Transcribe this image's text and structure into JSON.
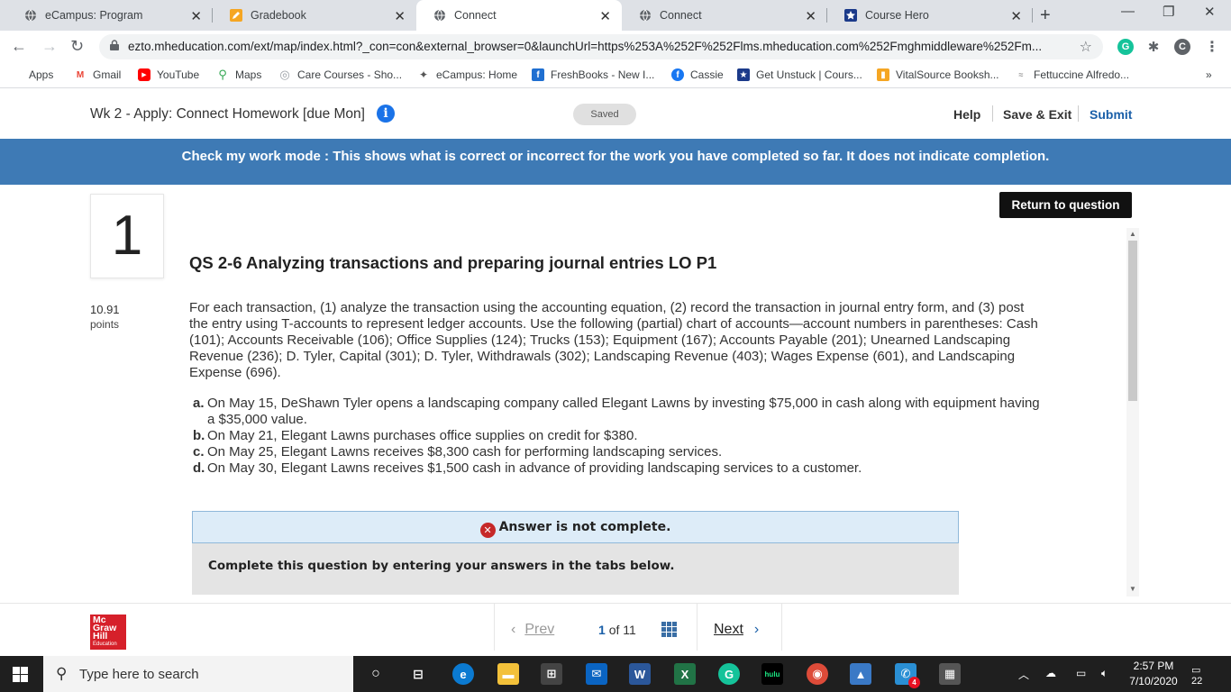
{
  "browser": {
    "tabs": [
      {
        "title": "eCampus: Program",
        "icon": "globe-icon"
      },
      {
        "title": "Gradebook",
        "icon": "pencil-icon"
      },
      {
        "title": "Connect",
        "icon": "globe-icon"
      },
      {
        "title": "Connect",
        "icon": "globe-icon"
      },
      {
        "title": "Course Hero",
        "icon": "star-icon"
      }
    ],
    "url": "ezto.mheducation.com/ext/map/index.html?_con=con&external_browser=0&launchUrl=https%253A%252F%252Flms.mheducation.com%252Fmghmiddleware%252Fm...",
    "extensions": [
      "G",
      "C"
    ],
    "bookmarks": [
      "Apps",
      "Gmail",
      "YouTube",
      "Maps",
      "Care Courses - Sho...",
      "eCampus: Home",
      "FreshBooks - New I...",
      "Cassie",
      "Get Unstuck | Cours...",
      "VitalSource Booksh...",
      "Fettuccine Alfredo..."
    ],
    "more": "»"
  },
  "header": {
    "assignment_title": "Wk 2 - Apply: Connect Homework [due Mon]",
    "status": "Saved",
    "help": "Help",
    "save_exit": "Save & Exit",
    "submit": "Submit"
  },
  "banner": "Check my work mode : This shows what is correct or incorrect for the work you have completed so far. It does not indicate completion.",
  "question": {
    "number": "1",
    "return_label": "Return to question",
    "title": "QS 2-6 Analyzing transactions and preparing journal entries LO P1",
    "points_value": "10.91",
    "points_label": "points",
    "text": "For each transaction, (1) analyze the transaction using the accounting equation, (2) record the transaction in journal entry form, and (3) post the entry using T-accounts to represent ledger accounts. Use the following (partial) chart of accounts—account numbers in parentheses: Cash (101); Accounts Receivable (106); Office Supplies (124); Trucks (153); Equipment (167); Accounts Payable (201); Unearned Landscaping Revenue (236); D. Tyler, Capital (301); D. Tyler, Withdrawals (302); Landscaping Revenue (403); Wages Expense (601), and Landscaping Expense (696).",
    "items": [
      {
        "letter": "a.",
        "text": "On May 15, DeShawn Tyler opens a landscaping company called Elegant Lawns by investing $75,000 in cash along with equipment having a $35,000 value."
      },
      {
        "letter": "b.",
        "text": "On May 21, Elegant Lawns purchases office supplies on credit for $380."
      },
      {
        "letter": "c.",
        "text": "On May 25, Elegant Lawns receives $8,300 cash for performing landscaping services."
      },
      {
        "letter": "d.",
        "text": "On May 30, Elegant Lawns receives $1,500 cash in advance of providing landscaping services to a customer."
      }
    ],
    "answer_status": "Answer is not complete.",
    "instruction": "Complete this question by entering your answers in the tabs below."
  },
  "footer": {
    "logo_lines": [
      "Mc",
      "Graw",
      "Hill",
      "Education"
    ],
    "prev": "Prev",
    "current_page": "1",
    "of_label": "of",
    "total_pages": "11",
    "next": "Next"
  },
  "taskbar": {
    "search_placeholder": "Type here to search",
    "time": "2:57 PM",
    "date": "7/10/2020",
    "notifications": "22",
    "mail_badge": "4"
  },
  "colors": {
    "banner_blue": "#3e7ab5",
    "mhe_red": "#d6202a",
    "error_red": "#c62828"
  }
}
